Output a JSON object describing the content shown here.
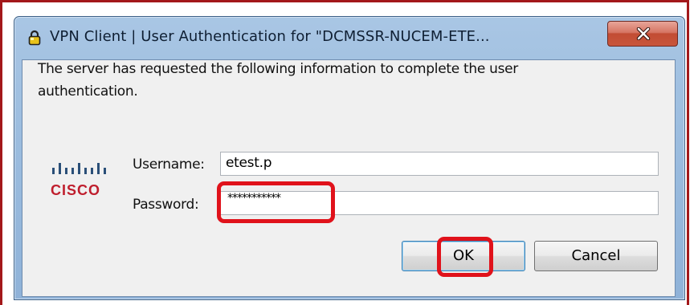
{
  "window": {
    "title": "VPN Client  |  User Authentication for \"DCMSSR-NUCEM-ETE..."
  },
  "dialog": {
    "prompt": "The server has requested the following information to complete the user authentication.",
    "logo_text": "CISCO",
    "username_label": "Username:",
    "username_value": "etest.p",
    "password_label": "Password:",
    "password_value": "***********",
    "ok_label": "OK",
    "cancel_label": "Cancel"
  },
  "icons": {
    "title_icon": "lock-icon",
    "close": "close-icon",
    "logo": "cisco-logo-icon"
  },
  "colors": {
    "frame": "#a3181a",
    "highlight": "#e0121b",
    "cisco_red": "#bf1e2d",
    "close_button": "#c8563c"
  }
}
